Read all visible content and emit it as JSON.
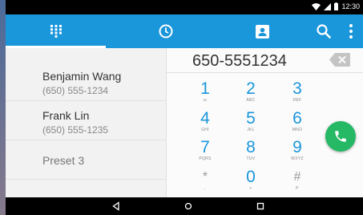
{
  "status_bar": {
    "time": "12:30"
  },
  "tabs": [
    {
      "name": "dialpad",
      "icon": "dialpad-icon",
      "selected": true
    },
    {
      "name": "recents",
      "icon": "clock-icon",
      "selected": false
    },
    {
      "name": "contacts",
      "icon": "contacts-icon",
      "selected": false
    }
  ],
  "actions": {
    "search_icon": "search-icon",
    "more_icon": "more-vert-icon"
  },
  "contacts": [
    {
      "name": "Benjamin Wang",
      "phone": "(650) 555-1234"
    },
    {
      "name": "Frank Lin",
      "phone": "(650) 555-1235"
    },
    {
      "name": "Preset 3",
      "phone": ""
    }
  ],
  "dialpad": {
    "number": "650-5551234",
    "keys": [
      {
        "digit": "1",
        "letters": "ω"
      },
      {
        "digit": "2",
        "letters": "ABC"
      },
      {
        "digit": "3",
        "letters": "DEF"
      },
      {
        "digit": "4",
        "letters": "GHI"
      },
      {
        "digit": "5",
        "letters": "JKL"
      },
      {
        "digit": "6",
        "letters": "MNO"
      },
      {
        "digit": "7",
        "letters": "PQRS"
      },
      {
        "digit": "8",
        "letters": "TUV"
      },
      {
        "digit": "9",
        "letters": "WXYZ"
      },
      {
        "digit": "*",
        "letters": ","
      },
      {
        "digit": "0",
        "letters": "+"
      },
      {
        "digit": "#",
        "letters": "P"
      }
    ]
  },
  "colors": {
    "accent": "#1a96db",
    "call": "#25b865",
    "status_bar": "#000000"
  },
  "nav": {
    "back_icon": "back-icon",
    "home_icon": "home-icon",
    "recents_icon": "recent-apps-icon"
  }
}
